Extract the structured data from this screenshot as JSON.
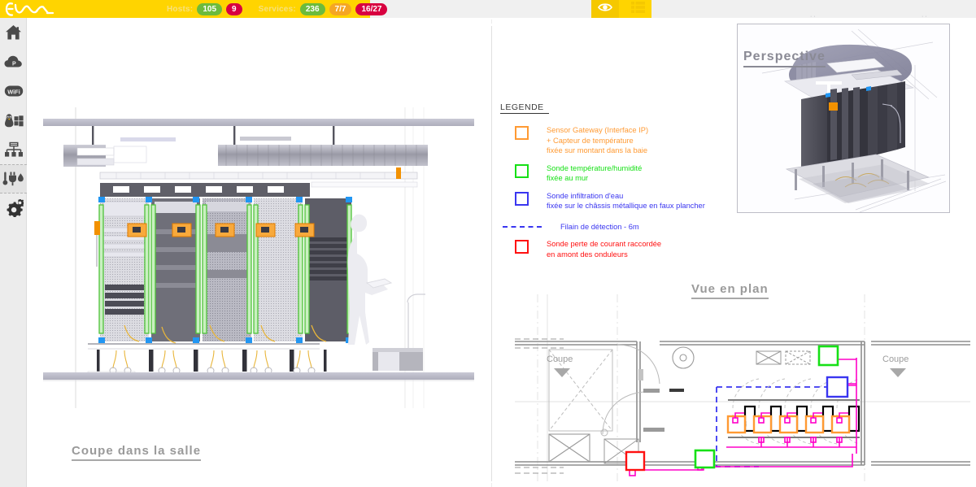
{
  "topbar": {
    "brand": "EVA",
    "hosts_label": "Hosts:",
    "hosts_up": "105",
    "hosts_down": "9",
    "services_label": "Services:",
    "services_ok": "236",
    "services_warn": "7/7",
    "services_crit": "16/27",
    "eye_icon": "eye-icon",
    "grid_icon": "grid-view-icon",
    "colors": {
      "yellow": "#FFD400",
      "green": "#6cbb3c",
      "crimson": "#d80040",
      "orange": "#f5a623",
      "label": "#f7e07c"
    }
  },
  "sidebar": {
    "items": [
      {
        "icon": "home-icon",
        "name": "sidebar-item-home",
        "active": false
      },
      {
        "icon": "cloud-icon",
        "name": "sidebar-item-cloud",
        "active": false
      },
      {
        "icon": "wifi-icon",
        "name": "sidebar-item-wifi",
        "active": false
      },
      {
        "icon": "os-icon",
        "name": "sidebar-item-systems",
        "active": false
      },
      {
        "icon": "network-icon",
        "name": "sidebar-item-network",
        "active": false
      },
      {
        "icon": "sensors-icon",
        "name": "sidebar-item-sensors",
        "active": true
      },
      {
        "icon": "gears-icon",
        "name": "sidebar-item-settings",
        "active": false
      }
    ]
  },
  "drawing": {
    "titles": {
      "coupe": "Coupe dans la salle",
      "vue_en_plan": "Vue en plan",
      "perspective": "Perspective"
    },
    "coupe_labels": {
      "left": "Coupe",
      "right": "Coupe"
    }
  },
  "legend": {
    "title": "LEGENDE",
    "entries": [
      {
        "marker": "square",
        "color": "#FF9A33",
        "color_name": "orange",
        "lines": [
          "Sensor Gateway (Interface IP)",
          "+ Capteur de température",
          "fixée sur montant dans la baie"
        ]
      },
      {
        "marker": "square",
        "color": "#16E016",
        "color_name": "green",
        "lines": [
          "Sonde température/humidité",
          "fixée au mur"
        ]
      },
      {
        "marker": "square",
        "color": "#3A36F0",
        "color_name": "blue",
        "lines": [
          "Sonde infiltration d'eau",
          "fixée sur le châssis métallique en faux plancher"
        ]
      },
      {
        "marker": "dashed-line",
        "color": "#3A36F0",
        "color_name": "blue",
        "lines": [
          "Filain de détection - 6m"
        ]
      },
      {
        "marker": "square",
        "color": "#FF1010",
        "color_name": "red",
        "lines": [
          "Sonde perte de courant raccordée",
          "en amont des onduleurs"
        ]
      }
    ]
  }
}
